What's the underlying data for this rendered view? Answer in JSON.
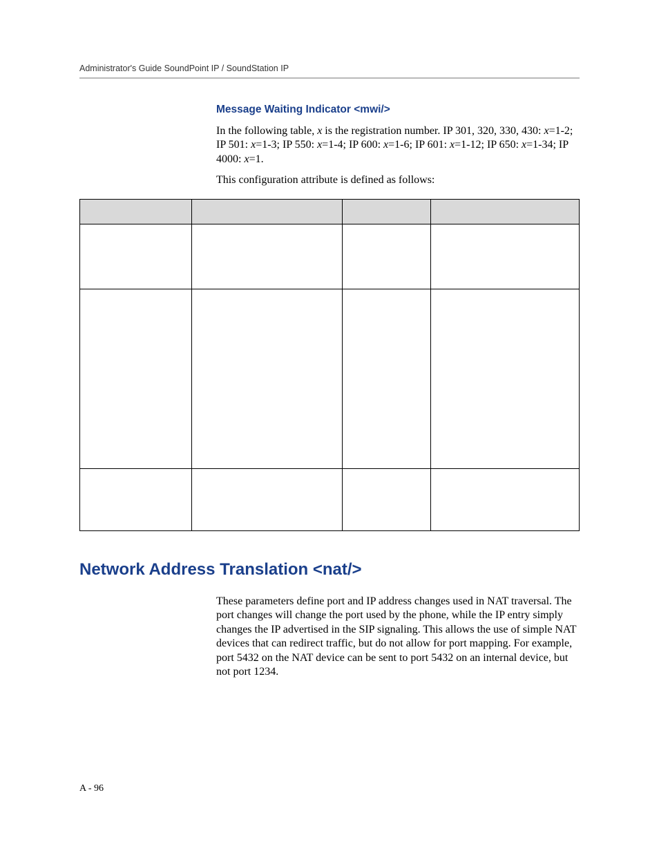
{
  "header": {
    "running": "Administrator's Guide SoundPoint IP / SoundStation IP"
  },
  "mwi": {
    "title": "Message Waiting Indicator <mwi/>",
    "para1_prefix": "In the following table, ",
    "para1_var1": "x",
    "para1_mid1": " is the registration number. IP 301, 320, 330, 430: ",
    "para1_var2": "x",
    "para1_mid2": "=1-2; IP 501: ",
    "para1_var3": "x",
    "para1_mid3": "=1-3; IP 550: ",
    "para1_var4": "x",
    "para1_mid4": "=1-4; IP 600: ",
    "para1_var5": "x",
    "para1_mid5": "=1-6; IP 601: ",
    "para1_var6": "x",
    "para1_mid6": "=1-12; IP 650: ",
    "para1_var7": "x",
    "para1_mid7": "=1-34; IP 4000: ",
    "para1_var8": "x",
    "para1_end": "=1.",
    "para2": "This configuration attribute is defined as follows:"
  },
  "table": {
    "headers": [
      "",
      "",
      "",
      ""
    ],
    "rows": [
      {
        "c1": "",
        "c2": "",
        "c3": "",
        "c4": ""
      },
      {
        "c1": "",
        "c2": "",
        "c3": "",
        "c4": ""
      },
      {
        "c1": "",
        "c2": "",
        "c3": "",
        "c4": ""
      }
    ]
  },
  "nat": {
    "title": "Network Address Translation <nat/>",
    "para": "These parameters define port and IP address changes used in NAT traversal. The port changes will change the port used by the phone, while the IP entry simply changes the IP advertised in the SIP signaling. This allows the use of simple NAT devices that can redirect traffic, but do not allow for port mapping. For example, port 5432 on the NAT device can be sent to port 5432 on an internal device, but not port 1234."
  },
  "footer": {
    "page": "A - 96"
  }
}
